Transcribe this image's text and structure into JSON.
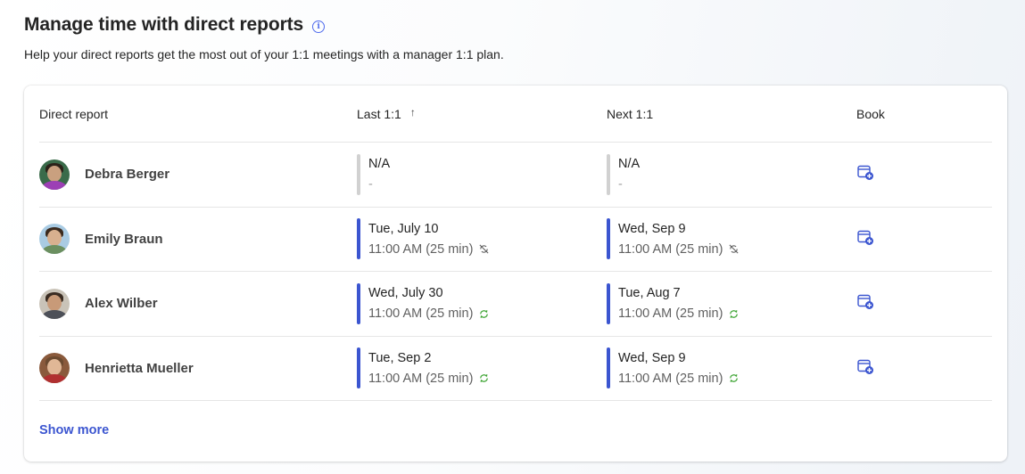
{
  "header": {
    "title": "Manage time with direct reports",
    "info_icon": "info-icon",
    "subtitle": "Help your direct reports get the most out of your 1:1 meetings with a manager 1:1 plan."
  },
  "table": {
    "columns": {
      "direct_report": "Direct report",
      "last": "Last 1:1",
      "last_sort": "↑",
      "next": "Next 1:1",
      "book": "Book"
    },
    "rows": [
      {
        "name": "Debra Berger",
        "last": {
          "date": "N/A",
          "time": "-",
          "status": "none"
        },
        "next": {
          "date": "N/A",
          "time": "-",
          "status": "none"
        }
      },
      {
        "name": "Emily Braun",
        "last": {
          "date": "Tue, July 10",
          "time": "11:00 AM (25 min)",
          "status": "recurrence-off"
        },
        "next": {
          "date": "Wed, Sep 9",
          "time": "11:00 AM (25 min)",
          "status": "recurrence-off"
        }
      },
      {
        "name": "Alex Wilber",
        "last": {
          "date": "Wed, July 30",
          "time": "11:00 AM (25 min)",
          "status": "recurring"
        },
        "next": {
          "date": "Tue, Aug 7",
          "time": "11:00 AM (25 min)",
          "status": "recurring"
        }
      },
      {
        "name": "Henrietta Mueller",
        "last": {
          "date": "Tue, Sep 2",
          "time": "11:00 AM (25 min)",
          "status": "recurring"
        },
        "next": {
          "date": "Wed, Sep 9",
          "time": "11:00 AM (25 min)",
          "status": "recurring"
        }
      }
    ],
    "show_more": "Show more"
  },
  "colors": {
    "accent": "#3b55d0",
    "recurring": "#3fa535",
    "bar_empty": "#d1d1d1"
  }
}
